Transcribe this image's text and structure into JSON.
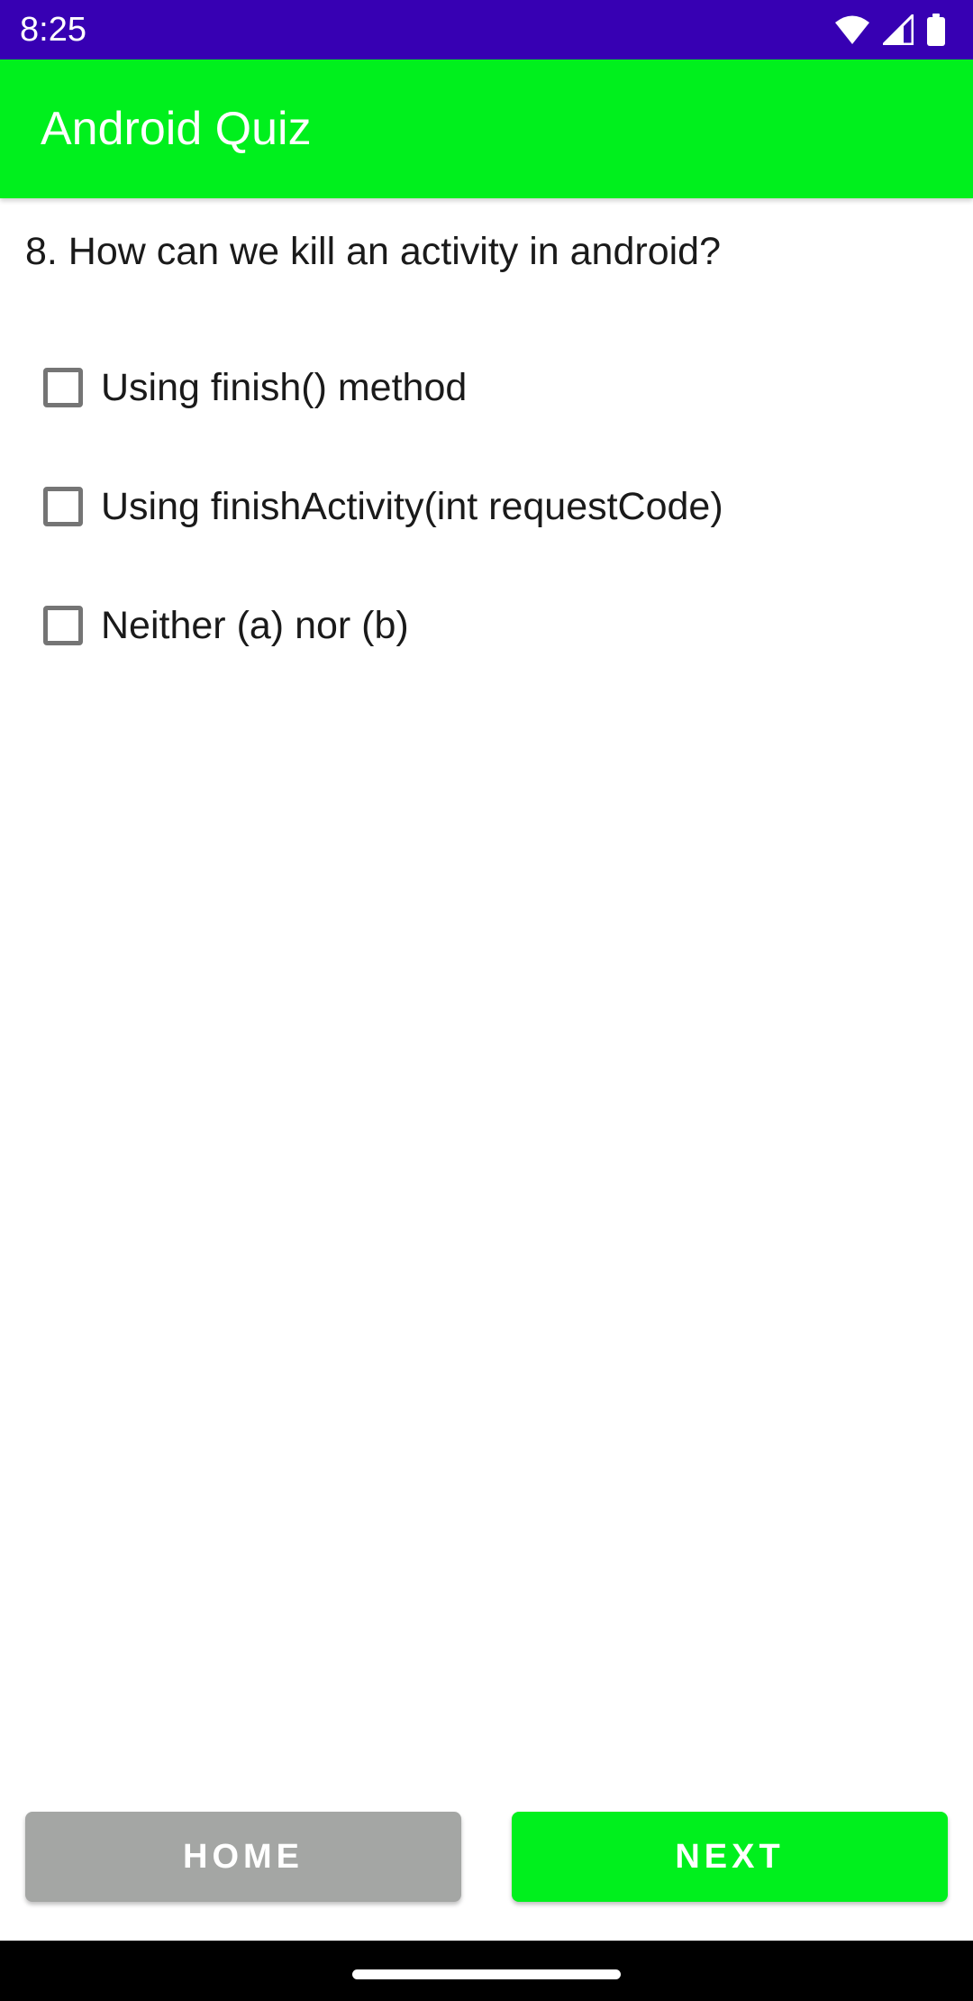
{
  "status_bar": {
    "time": "8:25",
    "icons": [
      "wifi-icon",
      "signal-icon",
      "battery-icon"
    ],
    "background": "#3700b3"
  },
  "app_bar": {
    "title": "Android Quiz",
    "background": "#00f01d"
  },
  "question": {
    "text": "8. How can we kill an activity in android?"
  },
  "options": [
    {
      "label": "Using finish() method",
      "checked": false
    },
    {
      "label": "Using finishActivity(int requestCode)",
      "checked": false
    },
    {
      "label": "Neither (a) nor (b)",
      "checked": false
    }
  ],
  "buttons": {
    "home_label": "HOME",
    "next_label": "NEXT",
    "home_color": "#a4a6a4",
    "next_color": "#00f01d"
  }
}
